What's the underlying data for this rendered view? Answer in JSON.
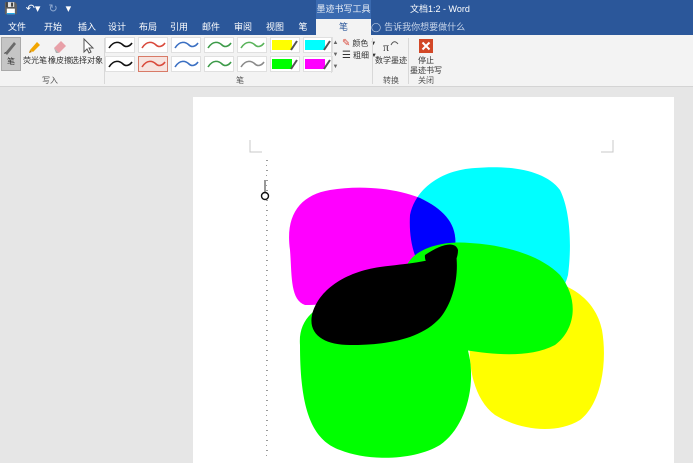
{
  "titlebar": {
    "contextual_group": "墨迹书写工具",
    "document_title": "文档1:2 - Word"
  },
  "tabs": [
    {
      "label": "文件"
    },
    {
      "label": "开始"
    },
    {
      "label": "插入"
    },
    {
      "label": "设计"
    },
    {
      "label": "布局"
    },
    {
      "label": "引用"
    },
    {
      "label": "邮件"
    },
    {
      "label": "审阅"
    },
    {
      "label": "视图"
    },
    {
      "label": "笔"
    },
    {
      "label": "笔"
    }
  ],
  "tell_me": "告诉我你想要做什么",
  "ribbon": {
    "groups": {
      "write": "写入",
      "pens": "笔",
      "convert": "转换",
      "close": "关闭"
    },
    "buttons": {
      "pen": "笔",
      "highlighter": "荧光笔",
      "eraser": "橡皮擦",
      "select_objects": "选择对象",
      "ink_to_math": "数学墨迹",
      "stop_inking": "停止\n墨迹书写"
    },
    "color_option": "颜色",
    "thickness_option": "粗细",
    "pen_colors": [
      "#111111",
      "#d9493b",
      "#3a6fc2",
      "#3c9a48",
      "#59b35a",
      "#ffff00",
      "#00ffff",
      "#111111",
      "#d9493b",
      "#3a6fc2",
      "#3c9a48",
      "#8a8a8a",
      "#00ff00",
      "#ff00ff"
    ]
  },
  "ink_colors": {
    "magenta": "#ff00ff",
    "cyan": "#00ffff",
    "yellow": "#ffff00",
    "green": "#00ff00",
    "black": "#000000",
    "blue": "#0000ff"
  }
}
